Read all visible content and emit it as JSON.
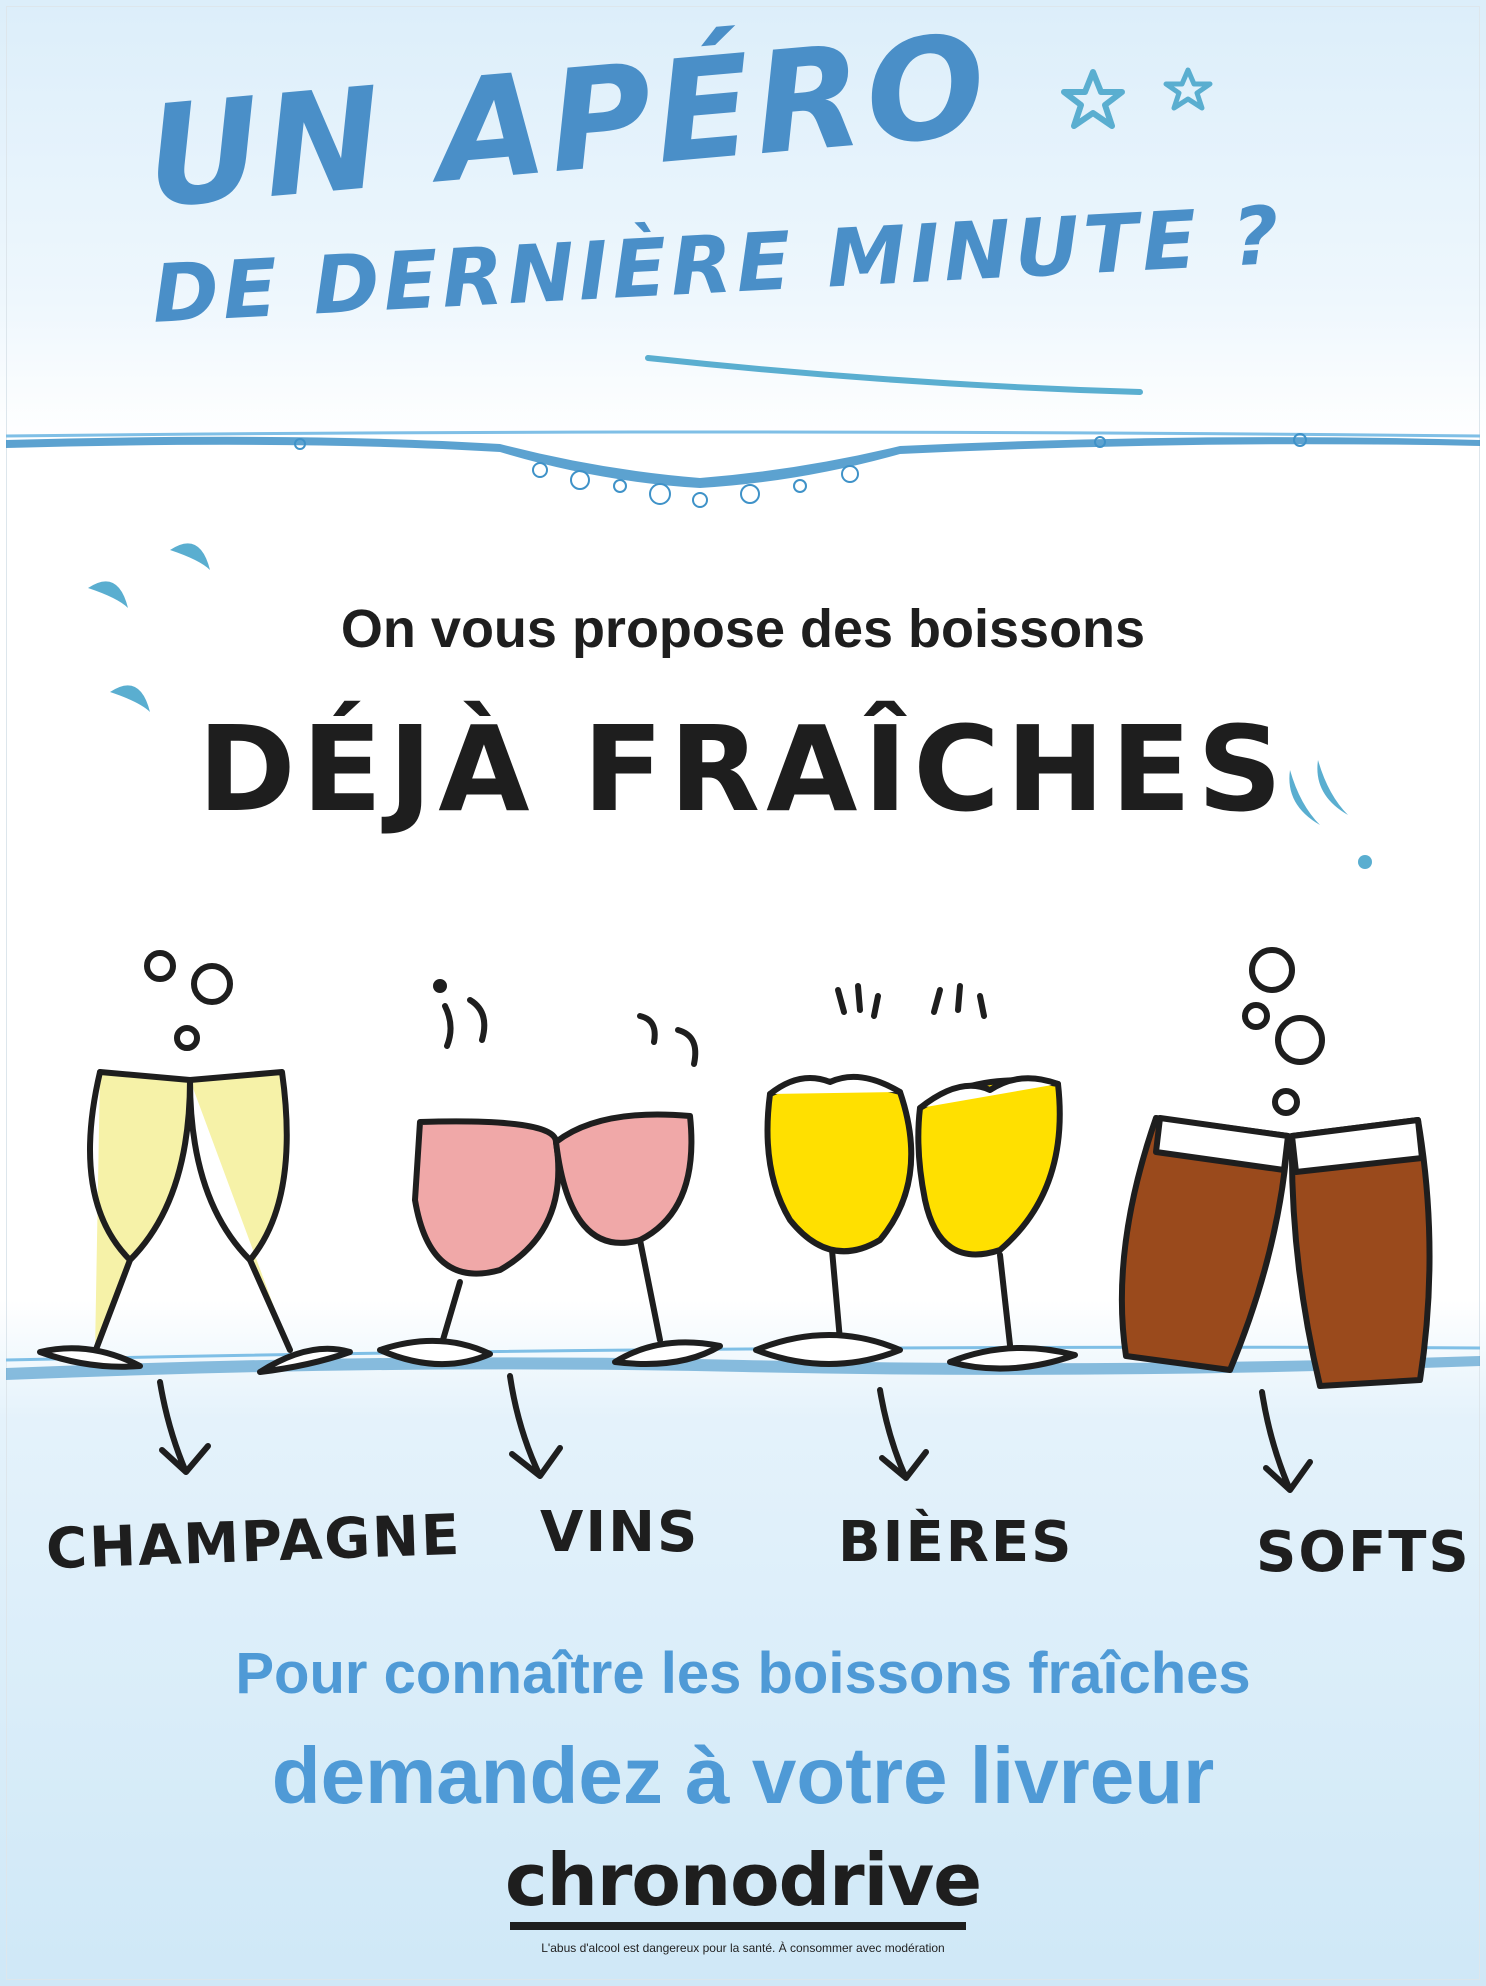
{
  "headline": {
    "line1": "UN APÉRO",
    "line2": "DE DERNIÈRE MINUTE ?"
  },
  "intro": "On vous propose des boissons",
  "highlight": "DÉJÀ FRAÎCHES",
  "drinks": [
    {
      "label": "CHAMPAGNE",
      "color": "#f6f2a8"
    },
    {
      "label": "VINS",
      "color": "#f0a8a8"
    },
    {
      "label": "BIÈRES",
      "color": "#ffe000"
    },
    {
      "label": "SOFTS",
      "color": "#9a4a1c"
    }
  ],
  "cta": {
    "line1": "Pour connaître les boissons fraîches",
    "line2": "demandez à votre livreur"
  },
  "brand": "chronodrive",
  "disclaimer": "L'abus d'alcool est dangereux pour la santé. À consommer avec modération",
  "colors": {
    "accent": "#4a8fc8",
    "accent_light": "#5aaed0",
    "text": "#1e1e1e",
    "water": "#3f92c8"
  },
  "icons": [
    "star-icon",
    "drop-icon",
    "bubble-icon",
    "arrow-icon"
  ]
}
